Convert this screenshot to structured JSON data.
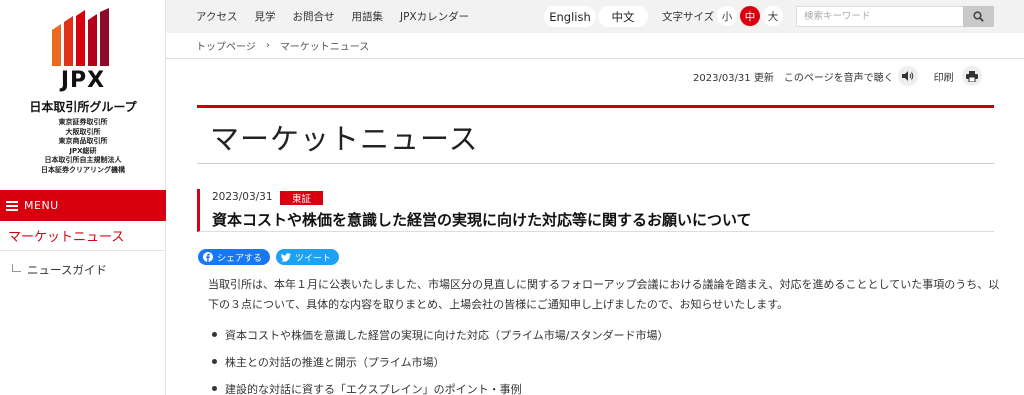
{
  "logo": {
    "mark_colors": [
      "#e8541e",
      "#d8000f",
      "#b5001c",
      "#8e0a2a"
    ],
    "name": "JPX",
    "group": "日本取引所グループ",
    "subsidiaries": [
      "東京証券取引所",
      "大阪取引所",
      "東京商品取引所",
      "JPX総研",
      "日本取引所自主規制法人",
      "日本証券クリアリング機構"
    ]
  },
  "sidebar": {
    "menu_label": "MENU",
    "current": "マーケットニュース",
    "sub_item": "ニュースガイド"
  },
  "topnav": {
    "links": [
      "アクセス",
      "見学",
      "お問合せ",
      "用語集",
      "JPXカレンダー"
    ],
    "lang_english": "English",
    "lang_chinese": "中文",
    "font_size_label": "文字サイズ",
    "font_sizes": [
      "小",
      "中",
      "大"
    ],
    "font_size_selected": "中",
    "search_placeholder": "検索キーワード"
  },
  "breadcrumb": {
    "home": "トップページ",
    "separator": "›",
    "current": "マーケットニュース"
  },
  "utility": {
    "updated": "2023/03/31 更新",
    "read_aloud": "このページを音声で聴く",
    "print": "印刷"
  },
  "page_title": "マーケットニュース",
  "article": {
    "date": "2023/03/31",
    "badge": "東証",
    "title": "資本コストや株価を意識した経営の実現に向けた対応等に関するお願いについて",
    "share_facebook": "シェアする",
    "share_twitter": "ツイート",
    "body": "当取引所は、本年１月に公表いたしました、市場区分の見直しに関するフォローアップ会議における議論を踏まえ、対応を進めることとしていた事項のうち、以下の３点について、具体的な内容を取りまとめ、上場会社の皆様にご通知申し上げましたので、お知らせいたします。",
    "bullets": [
      "資本コストや株価を意識した経営の実現に向けた対応（プライム市場/スタンダード市場）",
      "株主との対話の推進と開示（プライム市場）",
      "建設的な対話に資する「エクスプレイン」のポイント・事例"
    ]
  },
  "colors": {
    "brand_red": "#d8000f",
    "facebook": "#1877f2",
    "twitter": "#1da1f2"
  }
}
